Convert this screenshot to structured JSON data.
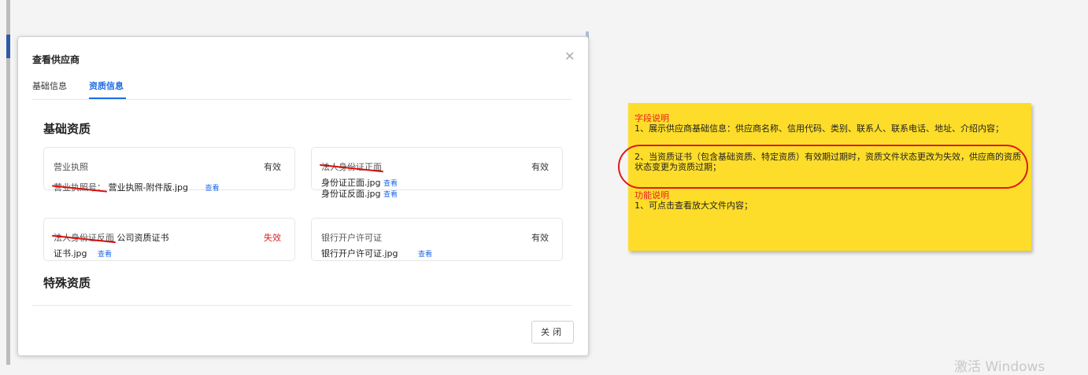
{
  "modal": {
    "title": "查看供应商",
    "close_icon": "close-icon",
    "tabs": [
      {
        "label": "基础信息",
        "active": false
      },
      {
        "label": "资质信息",
        "active": true
      }
    ],
    "basic_section_title": "基础资质",
    "special_section_title": "特殊资质",
    "cards": [
      {
        "label": "营业执照",
        "label_struck": false,
        "status": "有效",
        "status_ok": true,
        "lines": [
          {
            "prefix": "营业执照号：",
            "prefix_struck": true,
            "file": "营业执照-附件版.jpg",
            "link": "查看"
          }
        ]
      },
      {
        "label": "法人身份证正面",
        "label_struck": true,
        "status": "有效",
        "status_ok": true,
        "lines": [
          {
            "prefix": "",
            "file": "身份证正面.jpg",
            "link": "查看"
          },
          {
            "prefix": "",
            "file": "身份证反面.jpg",
            "link": "查看"
          }
        ]
      },
      {
        "label": "法人身份证反面",
        "label_struck": true,
        "label_suffix": "公司资质证书",
        "status": "失效",
        "status_ok": false,
        "lines": [
          {
            "prefix": "",
            "file": "证书.jpg",
            "link": "查看"
          }
        ]
      },
      {
        "label": "银行开户许可证",
        "label_struck": false,
        "status": "有效",
        "status_ok": true,
        "lines": [
          {
            "prefix": "",
            "file": "银行开户许可证.jpg",
            "link": "查看"
          }
        ]
      }
    ],
    "close_button_label": "关闭"
  },
  "note": {
    "field_heading": "字段说明",
    "field_item_1": "1、展示供应商基础信息：供应商名称、信用代码、类别、联系人、联系电话、地址、介绍内容；",
    "field_item_2": "2、当资质证书（包含基础资质、特定资质）有效期过期时，资质文件状态更改为失效，供应商的资质状态变更为资质过期；",
    "function_heading": "功能说明",
    "function_item_1": "1、可点击查看放大文件内容；",
    "colors": {
      "background": "#fddd2a",
      "heading": "#e81d1d",
      "highlight": "#e01818"
    }
  },
  "watermark": "激活 Windows",
  "colors": {
    "accent": "#1c6be8",
    "invalid": "#e02020"
  }
}
